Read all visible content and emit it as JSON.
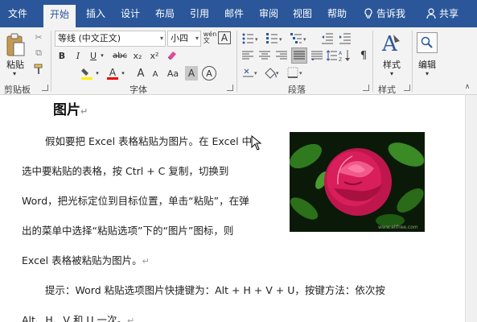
{
  "menu": {
    "tabs": [
      "文件",
      "开始",
      "插入",
      "设计",
      "布局",
      "引用",
      "邮件",
      "审阅",
      "视图",
      "帮助"
    ],
    "active_tab": "开始",
    "tell_me": "告诉我",
    "share": "共享"
  },
  "ribbon": {
    "paste_label": "粘贴",
    "font_name": "等线 (中文正文)",
    "font_size": "小四",
    "style_label": "样式",
    "edit_label": "编辑",
    "groups": {
      "clipboard": "剪贴板",
      "font": "字体",
      "paragraph": "段落",
      "styles": "样式"
    },
    "format_buttons": {
      "bold": "B",
      "italic": "I",
      "underline": "U",
      "strike": "abc",
      "subscript": "x₂",
      "superscript": "x²",
      "grow": "A",
      "shrink": "A",
      "aa": "Aa",
      "char_shade": "A",
      "char_circle": "A"
    }
  },
  "document": {
    "heading": "图片",
    "lines": [
      "假如要把 Excel 表格粘贴为图片。在 Excel 中",
      "选中要粘贴的表格，按 Ctrl + C 复制，切换到",
      "Word，把光标定位到目标位置，单击“粘贴”，在弹",
      "出的菜单中选择“粘贴选项”下的“图片”图标，则",
      "Excel 表格被粘贴为图片。"
    ],
    "tip_line1": "提示：Word 粘贴选项图片快捷键为：Alt + H + V + U，按键方法：依次按",
    "tip_line2": "Alt、H、V 和 U 一次。",
    "paragraph_mark": "↵",
    "image_watermark": "www.allfree.com"
  }
}
